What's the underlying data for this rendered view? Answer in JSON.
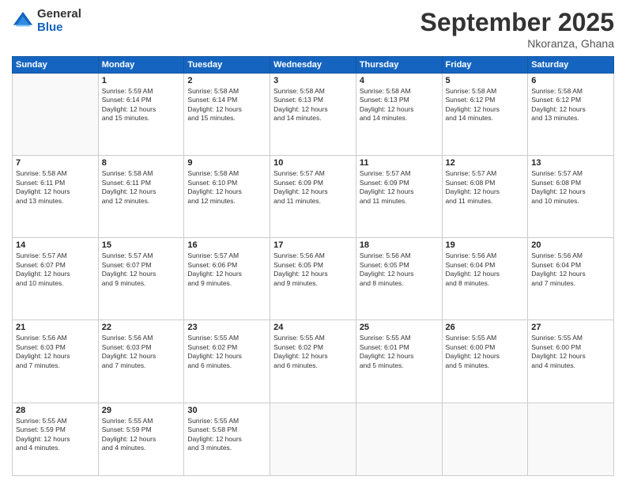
{
  "logo": {
    "general": "General",
    "blue": "Blue"
  },
  "header": {
    "month": "September 2025",
    "location": "Nkoranza, Ghana"
  },
  "weekdays": [
    "Sunday",
    "Monday",
    "Tuesday",
    "Wednesday",
    "Thursday",
    "Friday",
    "Saturday"
  ],
  "weeks": [
    [
      {
        "day": "",
        "info": ""
      },
      {
        "day": "1",
        "info": "Sunrise: 5:59 AM\nSunset: 6:14 PM\nDaylight: 12 hours\nand 15 minutes."
      },
      {
        "day": "2",
        "info": "Sunrise: 5:58 AM\nSunset: 6:14 PM\nDaylight: 12 hours\nand 15 minutes."
      },
      {
        "day": "3",
        "info": "Sunrise: 5:58 AM\nSunset: 6:13 PM\nDaylight: 12 hours\nand 14 minutes."
      },
      {
        "day": "4",
        "info": "Sunrise: 5:58 AM\nSunset: 6:13 PM\nDaylight: 12 hours\nand 14 minutes."
      },
      {
        "day": "5",
        "info": "Sunrise: 5:58 AM\nSunset: 6:12 PM\nDaylight: 12 hours\nand 14 minutes."
      },
      {
        "day": "6",
        "info": "Sunrise: 5:58 AM\nSunset: 6:12 PM\nDaylight: 12 hours\nand 13 minutes."
      }
    ],
    [
      {
        "day": "7",
        "info": "Sunrise: 5:58 AM\nSunset: 6:11 PM\nDaylight: 12 hours\nand 13 minutes."
      },
      {
        "day": "8",
        "info": "Sunrise: 5:58 AM\nSunset: 6:11 PM\nDaylight: 12 hours\nand 12 minutes."
      },
      {
        "day": "9",
        "info": "Sunrise: 5:58 AM\nSunset: 6:10 PM\nDaylight: 12 hours\nand 12 minutes."
      },
      {
        "day": "10",
        "info": "Sunrise: 5:57 AM\nSunset: 6:09 PM\nDaylight: 12 hours\nand 11 minutes."
      },
      {
        "day": "11",
        "info": "Sunrise: 5:57 AM\nSunset: 6:09 PM\nDaylight: 12 hours\nand 11 minutes."
      },
      {
        "day": "12",
        "info": "Sunrise: 5:57 AM\nSunset: 6:08 PM\nDaylight: 12 hours\nand 11 minutes."
      },
      {
        "day": "13",
        "info": "Sunrise: 5:57 AM\nSunset: 6:08 PM\nDaylight: 12 hours\nand 10 minutes."
      }
    ],
    [
      {
        "day": "14",
        "info": "Sunrise: 5:57 AM\nSunset: 6:07 PM\nDaylight: 12 hours\nand 10 minutes."
      },
      {
        "day": "15",
        "info": "Sunrise: 5:57 AM\nSunset: 6:07 PM\nDaylight: 12 hours\nand 9 minutes."
      },
      {
        "day": "16",
        "info": "Sunrise: 5:57 AM\nSunset: 6:06 PM\nDaylight: 12 hours\nand 9 minutes."
      },
      {
        "day": "17",
        "info": "Sunrise: 5:56 AM\nSunset: 6:05 PM\nDaylight: 12 hours\nand 9 minutes."
      },
      {
        "day": "18",
        "info": "Sunrise: 5:56 AM\nSunset: 6:05 PM\nDaylight: 12 hours\nand 8 minutes."
      },
      {
        "day": "19",
        "info": "Sunrise: 5:56 AM\nSunset: 6:04 PM\nDaylight: 12 hours\nand 8 minutes."
      },
      {
        "day": "20",
        "info": "Sunrise: 5:56 AM\nSunset: 6:04 PM\nDaylight: 12 hours\nand 7 minutes."
      }
    ],
    [
      {
        "day": "21",
        "info": "Sunrise: 5:56 AM\nSunset: 6:03 PM\nDaylight: 12 hours\nand 7 minutes."
      },
      {
        "day": "22",
        "info": "Sunrise: 5:56 AM\nSunset: 6:03 PM\nDaylight: 12 hours\nand 7 minutes."
      },
      {
        "day": "23",
        "info": "Sunrise: 5:55 AM\nSunset: 6:02 PM\nDaylight: 12 hours\nand 6 minutes."
      },
      {
        "day": "24",
        "info": "Sunrise: 5:55 AM\nSunset: 6:02 PM\nDaylight: 12 hours\nand 6 minutes."
      },
      {
        "day": "25",
        "info": "Sunrise: 5:55 AM\nSunset: 6:01 PM\nDaylight: 12 hours\nand 5 minutes."
      },
      {
        "day": "26",
        "info": "Sunrise: 5:55 AM\nSunset: 6:00 PM\nDaylight: 12 hours\nand 5 minutes."
      },
      {
        "day": "27",
        "info": "Sunrise: 5:55 AM\nSunset: 6:00 PM\nDaylight: 12 hours\nand 4 minutes."
      }
    ],
    [
      {
        "day": "28",
        "info": "Sunrise: 5:55 AM\nSunset: 5:59 PM\nDaylight: 12 hours\nand 4 minutes."
      },
      {
        "day": "29",
        "info": "Sunrise: 5:55 AM\nSunset: 5:59 PM\nDaylight: 12 hours\nand 4 minutes."
      },
      {
        "day": "30",
        "info": "Sunrise: 5:55 AM\nSunset: 5:58 PM\nDaylight: 12 hours\nand 3 minutes."
      },
      {
        "day": "",
        "info": ""
      },
      {
        "day": "",
        "info": ""
      },
      {
        "day": "",
        "info": ""
      },
      {
        "day": "",
        "info": ""
      }
    ]
  ]
}
